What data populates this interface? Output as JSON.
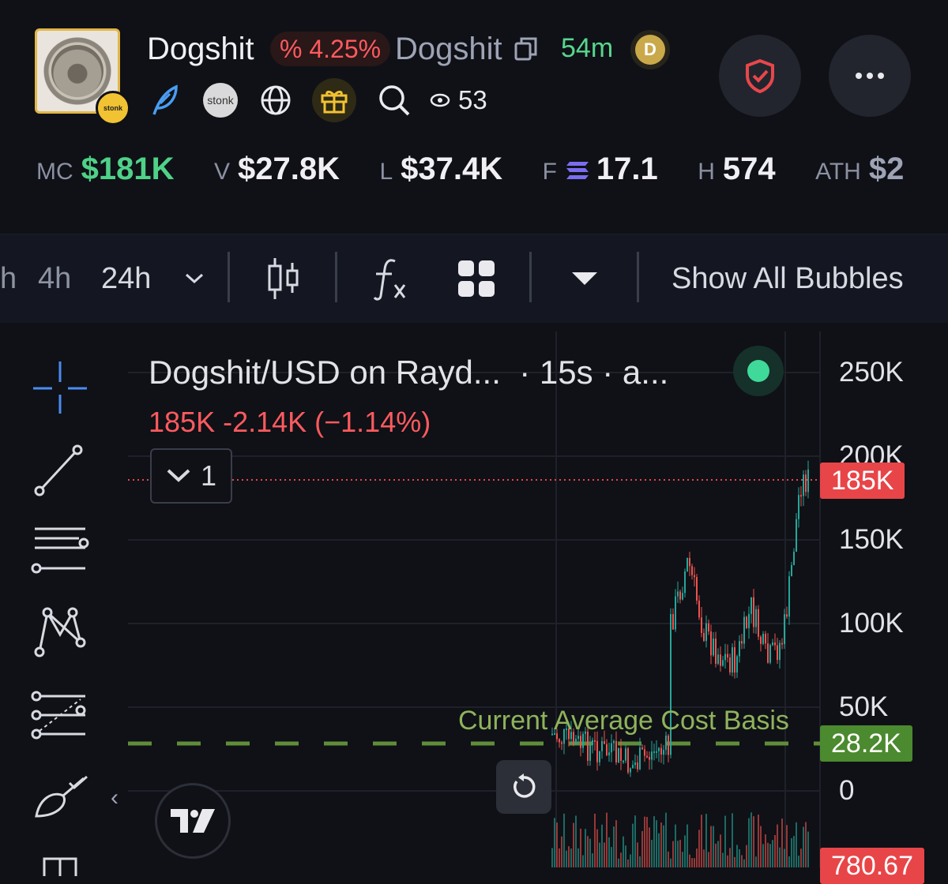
{
  "header": {
    "token_name": "Dogshit",
    "change_pct": "% 4.25%",
    "ticker": "Dogshit",
    "age": "54m",
    "platform_badge": "stonk",
    "icons": [
      "feather-icon",
      "stonk-badge",
      "globe-icon",
      "gift-icon",
      "search-icon",
      "eye-icon"
    ],
    "views": "53"
  },
  "stats": [
    {
      "label": "MC",
      "value": "$181K",
      "accent": "#4fd188"
    },
    {
      "label": "V",
      "value": "$27.8K"
    },
    {
      "label": "L",
      "value": "$37.4K"
    },
    {
      "label": "F",
      "value": "17.1"
    },
    {
      "label": "H",
      "value": "574"
    },
    {
      "label": "ATH",
      "value": "$2"
    }
  ],
  "toolbar": {
    "partial_left": "h",
    "interval_4h": "4h",
    "interval_24h": "24h",
    "show_bubbles": "Show All Bubbles"
  },
  "chart": {
    "title": "Dogshit/USD on Rayd...",
    "meta": "· 15s · a...",
    "price_line": "185K  -2.14K (−1.14%)",
    "collapse_count": "1",
    "cost_basis_label": "Current Average Cost Basis",
    "y_ticks": [
      "250K",
      "200K",
      "150K",
      "100K",
      "50K",
      "0"
    ],
    "current_price_tag": "185K",
    "cost_basis_tag": "28.2K",
    "bottom_tag": "780.67",
    "colors": {
      "up": "#26a69a",
      "down": "#ef5350",
      "cost_line": "#5f8d3a",
      "price_tag": "#e84548",
      "cost_tag": "#4b8a2e"
    }
  }
}
